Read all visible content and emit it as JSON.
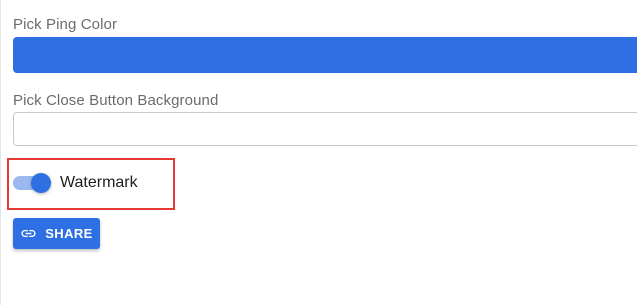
{
  "form": {
    "ping_color": {
      "label": "Pick Ping Color",
      "value_color": "#2f6fe4"
    },
    "close_button_background": {
      "label": "Pick Close Button Background",
      "value": ""
    },
    "watermark_toggle": {
      "label": "Watermark",
      "checked": true
    },
    "share_button": {
      "label": "SHARE",
      "icon": "link-icon"
    }
  },
  "highlight": {
    "target": "watermark-toggle",
    "color": "#e53935"
  },
  "colors": {
    "accent": "#2f6fe4",
    "toggle_track": "#9bb9ef"
  }
}
